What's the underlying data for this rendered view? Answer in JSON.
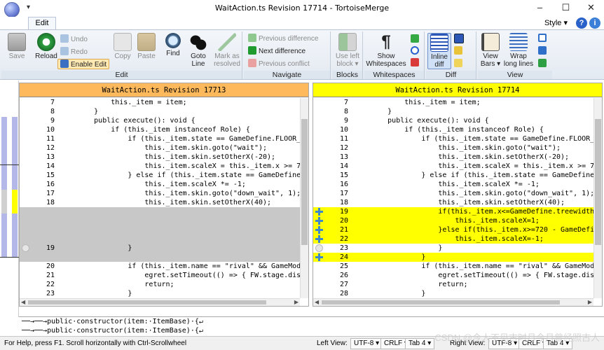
{
  "window": {
    "title": "WaitAction.ts Revision 17714 - TortoiseMerge",
    "minimize": "–",
    "maximize": "☐",
    "close": "✕",
    "qat_arrow": "▾"
  },
  "ribbon": {
    "active_tab": "Edit",
    "style_label": "Style ▾",
    "help_label": "?",
    "info_label": "i",
    "groups": {
      "edit": "Edit",
      "navigate": "Navigate",
      "blocks": "Blocks",
      "whitespaces": "Whitespaces",
      "diff": "Diff",
      "view": "View"
    },
    "buttons": {
      "save": "Save",
      "reload": "Reload",
      "undo": "Undo",
      "redo": "Redo",
      "enable_edit": "Enable Edit",
      "copy": "Copy",
      "paste": "Paste",
      "find": "Find",
      "goto_line_1": "Goto",
      "goto_line_2": "Line",
      "mark_resolved_1": "Mark as",
      "mark_resolved_2": "resolved",
      "previous_difference": "Previous difference",
      "next_difference": "Next difference",
      "previous_conflict": "Previous conflict",
      "use_left_block_1": "Use left",
      "use_left_block_2": "block ▾",
      "show_whitespaces_1": "Show",
      "show_whitespaces_2": "Whitespaces",
      "inline_diff_1": "Inline",
      "inline_diff_2": "diff",
      "view_bars_1": "View",
      "view_bars_2": "Bars ▾",
      "wrap_lines_1": "Wrap",
      "wrap_lines_2": "long lines"
    }
  },
  "left_pane": {
    "header": "WaitAction.ts Revision 17713",
    "lines": [
      {
        "n": "7",
        "t": "            this._item = item;",
        "k": "normal"
      },
      {
        "n": "8",
        "t": "        }",
        "k": "normal"
      },
      {
        "n": "9",
        "t": "        public execute(): void {",
        "k": "normal"
      },
      {
        "n": "10",
        "t": "            if (this._item instanceof Role) {",
        "k": "normal"
      },
      {
        "n": "11",
        "t": "                if (this._item.state == GameDefine.FLOOR_",
        "k": "normal"
      },
      {
        "n": "12",
        "t": "                    this._item.skin.goto(\"wait\");",
        "k": "normal"
      },
      {
        "n": "13",
        "t": "                    this._item.skin.setOtherX(-20);",
        "k": "normal"
      },
      {
        "n": "14",
        "t": "                    this._item.scaleX = this._item.x >= 7",
        "k": "normal"
      },
      {
        "n": "15",
        "t": "                } else if (this._item.state == GameDefine",
        "k": "normal"
      },
      {
        "n": "16",
        "t": "                    this._item.scaleX *= -1;",
        "k": "normal"
      },
      {
        "n": "17",
        "t": "                    this._item.skin.goto(\"down_wait\", 1);",
        "k": "normal"
      },
      {
        "n": "18",
        "t": "                    this._item.skin.setOtherX(40);",
        "k": "normal"
      },
      {
        "n": "",
        "t": "",
        "k": "empty"
      },
      {
        "n": "",
        "t": "",
        "k": "empty"
      },
      {
        "n": "",
        "t": "",
        "k": "empty"
      },
      {
        "n": "",
        "t": "",
        "k": "empty"
      },
      {
        "n": "19",
        "t": "                }",
        "k": "empty",
        "m": "dot"
      },
      {
        "n": "",
        "t": "",
        "k": "empty"
      },
      {
        "n": "20",
        "t": "                if (this._item.name == \"rival\" && GameMod",
        "k": "normal"
      },
      {
        "n": "21",
        "t": "                    egret.setTimeout(() => { FW.stage.dis",
        "k": "normal"
      },
      {
        "n": "22",
        "t": "                    return;",
        "k": "normal"
      },
      {
        "n": "23",
        "t": "                }",
        "k": "normal"
      },
      {
        "n": "24",
        "t": "                if (this._item.name != \"role\" || GameMode",
        "k": "normal"
      }
    ]
  },
  "right_pane": {
    "header": "WaitAction.ts Revision 17714",
    "lines": [
      {
        "n": "7",
        "t": "            this._item = item;",
        "k": "normal"
      },
      {
        "n": "8",
        "t": "        }",
        "k": "normal"
      },
      {
        "n": "9",
        "t": "        public execute(): void {",
        "k": "normal"
      },
      {
        "n": "10",
        "t": "            if (this._item instanceof Role) {",
        "k": "normal"
      },
      {
        "n": "11",
        "t": "                if (this._item.state == GameDefine.FLOOR_",
        "k": "normal"
      },
      {
        "n": "12",
        "t": "                    this._item.skin.goto(\"wait\");",
        "k": "normal"
      },
      {
        "n": "13",
        "t": "                    this._item.skin.setOtherX(-20);",
        "k": "normal"
      },
      {
        "n": "14",
        "t": "                    this._item.scaleX = this._item.x >= 7",
        "k": "normal"
      },
      {
        "n": "15",
        "t": "                } else if (this._item.state == GameDefine",
        "k": "normal"
      },
      {
        "n": "16",
        "t": "                    this._item.scaleX *= -1;",
        "k": "normal"
      },
      {
        "n": "17",
        "t": "                    this._item.skin.goto(\"down_wait\", 1);",
        "k": "normal"
      },
      {
        "n": "18",
        "t": "                    this._item.skin.setOtherX(40);",
        "k": "normal"
      },
      {
        "n": "19",
        "t": "                    if(this._item.x<=GameDefine.treewidth",
        "k": "added",
        "m": "plus"
      },
      {
        "n": "20",
        "t": "                        this._item.scaleX=1;",
        "k": "added",
        "m": "plus"
      },
      {
        "n": "21",
        "t": "                    }else if(this._item.x>=720 - GameDefi",
        "k": "added",
        "m": "plus"
      },
      {
        "n": "22",
        "t": "                        this._item.scaleX=-1;",
        "k": "added",
        "m": "plus"
      },
      {
        "n": "23",
        "t": "                    }",
        "k": "normal",
        "m": "dot"
      },
      {
        "n": "24",
        "t": "                }",
        "k": "added",
        "m": "plus"
      },
      {
        "n": "25",
        "t": "                if (this._item.name == \"rival\" && GameMod",
        "k": "normal"
      },
      {
        "n": "26",
        "t": "                    egret.setTimeout(() => { FW.stage.dis",
        "k": "normal"
      },
      {
        "n": "27",
        "t": "                    return;",
        "k": "normal"
      },
      {
        "n": "28",
        "t": "                }",
        "k": "normal"
      },
      {
        "n": "29",
        "t": "                if (this._item.name != \"role\" || GameMode",
        "k": "normal"
      }
    ]
  },
  "bottom_view": {
    "line1": "──→──→public·constructor(item:·ItemBase)·{↵",
    "line2": "──→──→public·constructor(item:·ItemBase)·{↵"
  },
  "status": {
    "help": "For Help, press F1. Scroll horizontally with Ctrl-Scrollwheel",
    "left_view_label": "Left View:",
    "left_encoding": "UTF-8 ▾",
    "left_eol": "CRLF ▾",
    "left_tab": "Tab 4 ▾",
    "right_view_label": "Right View:",
    "right_encoding": "UTF-8 ▾",
    "right_eol": "CRLF ▾",
    "right_tab": "Tab 4 ▾"
  },
  "watermark": "CSDN @今人不见古时月今月曾经照古人",
  "colors": {
    "left_header": "#fdb95c",
    "right_header": "#ffff00",
    "added": "#ffff00",
    "empty": "#c8c8c8",
    "locbar_blue": "#b3b8e8"
  }
}
